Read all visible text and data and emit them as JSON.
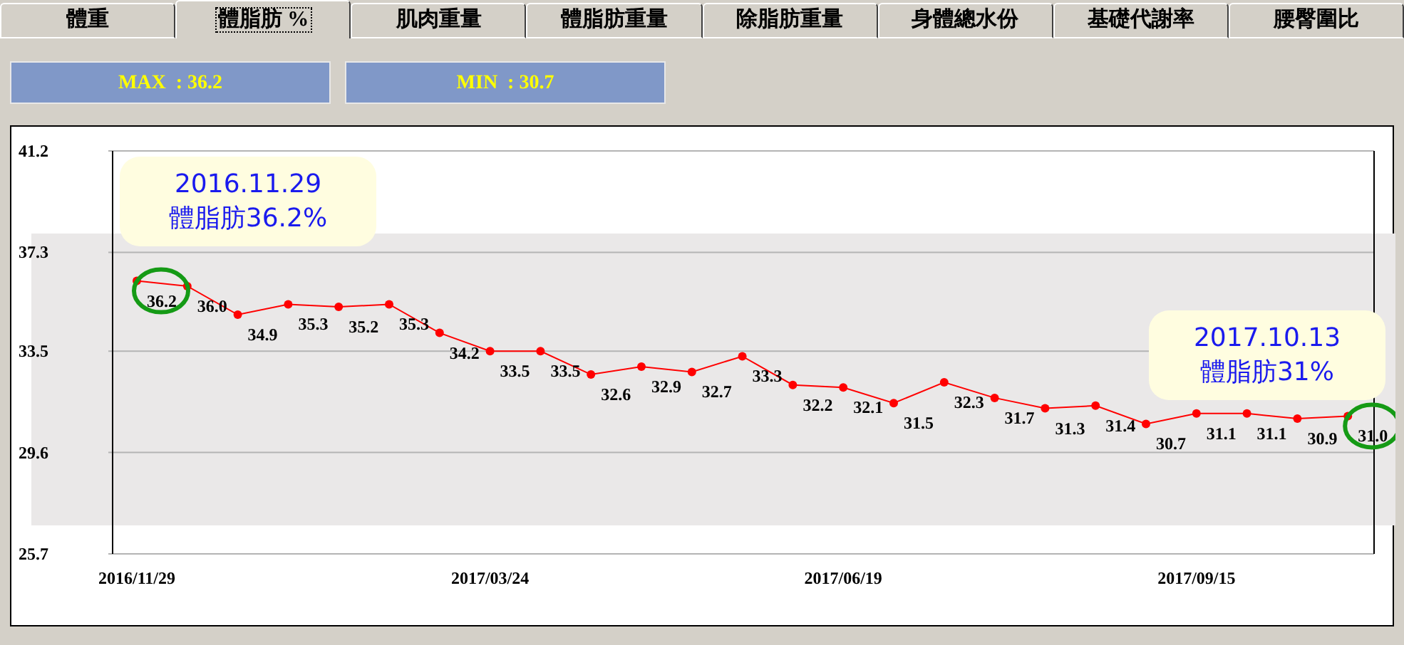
{
  "tabs": [
    {
      "label": "體重",
      "selected": false
    },
    {
      "label": "體脂肪 %",
      "selected": true
    },
    {
      "label": "肌肉重量",
      "selected": false
    },
    {
      "label": "體脂肪重量",
      "selected": false
    },
    {
      "label": "除脂肪重量",
      "selected": false
    },
    {
      "label": "身體總水份",
      "selected": false
    },
    {
      "label": "基礎代謝率",
      "selected": false
    },
    {
      "label": "腰臀圍比",
      "selected": false
    }
  ],
  "stats": [
    {
      "label": "MAX  : 36.2"
    },
    {
      "label": "MIN  : 30.7"
    }
  ],
  "chart": {
    "chart_data": {
      "type": "line",
      "ylim": [
        25.7,
        41.2
      ],
      "yticks": [
        25.7,
        29.6,
        33.5,
        37.3,
        41.2
      ],
      "grid": true,
      "categories": [
        "2016/11/29",
        null,
        null,
        null,
        null,
        null,
        null,
        "2017/03/24",
        null,
        null,
        null,
        null,
        null,
        null,
        "2017/06/19",
        null,
        null,
        null,
        null,
        null,
        null,
        "2017/09/15",
        null,
        null,
        null
      ],
      "series": [
        {
          "color": "#ff0000",
          "marker": "circle",
          "values": [
            36.2,
            36.0,
            34.9,
            35.3,
            35.2,
            35.3,
            34.2,
            33.5,
            33.5,
            32.6,
            32.9,
            32.7,
            33.3,
            32.2,
            32.1,
            31.5,
            32.3,
            31.7,
            31.3,
            31.4,
            30.7,
            31.1,
            31.1,
            30.9,
            31.0
          ],
          "value_labels": [
            "36.2",
            "36.0",
            "34.9",
            "35.3",
            "35.2",
            "35.3",
            "34.2",
            "33.5",
            "33.5",
            "32.6",
            "32.9",
            "32.7",
            "33.3",
            "32.2",
            "32.1",
            "31.5",
            "32.3",
            "31.7",
            "31.3",
            "31.4",
            "30.7",
            "31.1",
            "31.1",
            "30.9",
            "31.0"
          ]
        }
      ]
    },
    "callouts": [
      {
        "title": "2016.11.29",
        "text": "體脂肪36.2%",
        "kind": "first"
      },
      {
        "title": "2017.10.13",
        "text": "體脂肪31%",
        "kind": "last"
      }
    ]
  }
}
